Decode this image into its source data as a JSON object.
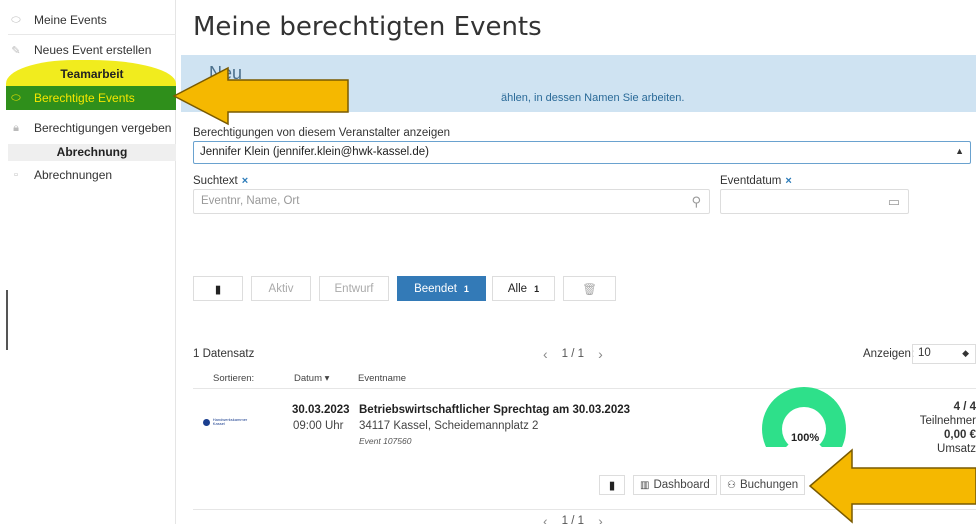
{
  "sidebar": {
    "items": [
      {
        "label": "Meine Events",
        "icon": "tag-icon"
      },
      {
        "label": "Neues Event erstellen",
        "icon": "pencil-icon"
      },
      {
        "label": "Berechtigte Events",
        "icon": "tag-icon"
      },
      {
        "label": "Berechtigungen vergeben",
        "icon": "lock-icon"
      },
      {
        "label": "Abrechnungen",
        "icon": "document-icon"
      }
    ],
    "headings": {
      "team": "Teamarbeit",
      "billing": "Abrechnung"
    }
  },
  "page": {
    "title": "Meine berechtigten Events"
  },
  "info_box": {
    "heading": "Neu",
    "text": "ählen, in dessen Namen Sie arbeiten."
  },
  "organizer": {
    "label": "Berechtigungen von diesem Veranstalter anzeigen",
    "selected": "Jennifer Klein (jennifer.klein@hwk-kassel.de)"
  },
  "search": {
    "label": "Suchtext",
    "clear": "×",
    "placeholder": "Eventnr, Name, Ort"
  },
  "date_filter": {
    "label": "Eventdatum",
    "clear": "×"
  },
  "filters": {
    "aktiv": "Aktiv",
    "entwurf": "Entwurf",
    "beendet": "Beendet",
    "beendet_count": "1",
    "alle": "Alle",
    "alle_count": "1"
  },
  "list": {
    "count_text": "1 Datensatz",
    "page": "1 / 1",
    "show_label": "Anzeigen:",
    "show_value": "10",
    "sort_label": "Sortieren:",
    "col_date": "Datum",
    "col_name": "Eventname"
  },
  "event": {
    "date": "30.03.2023",
    "time": "09:00 Uhr",
    "name": "Betriebswirtschaftlicher Sprechtag am 30.03.2023",
    "location": "34117 Kassel, Scheidemannplatz 2",
    "event_id": "Event 107560",
    "org_logo_text": "Handwerkskammer Kassel",
    "fill_percent": "100%",
    "participants": "4 / 4",
    "participants_label": "Teilnehmer",
    "revenue": "0,00 €",
    "revenue_label": "Umsatz",
    "btn_dashboard": "Dashboard",
    "btn_bookings": "Buchungen"
  },
  "colors": {
    "primary": "#337ab7",
    "active_sidebar": "#2f8f1b",
    "highlight": "#f5e600",
    "info_bg": "#cfe3f2",
    "gauge": "#2ee08a",
    "annotation_arrow": "#f5b800"
  }
}
